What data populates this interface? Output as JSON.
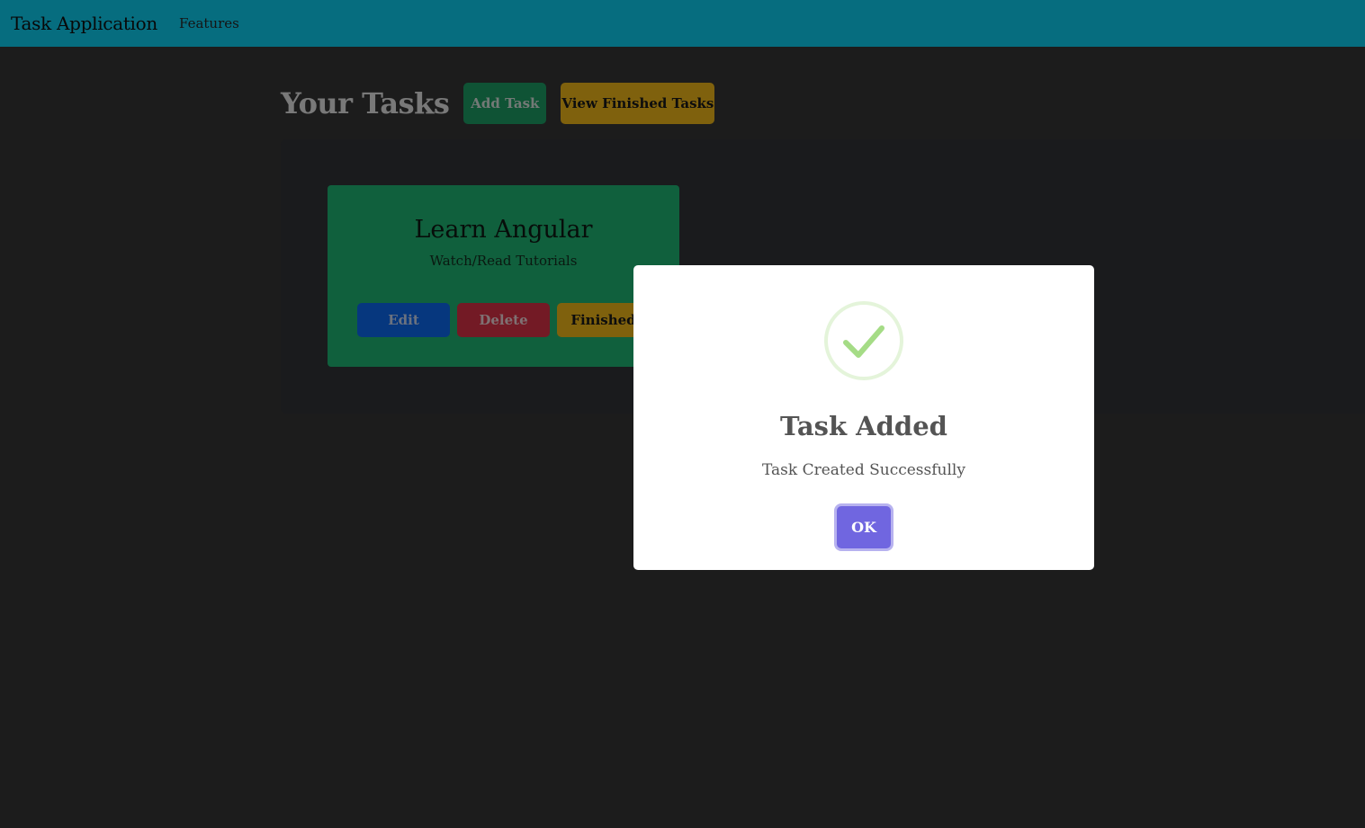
{
  "navbar": {
    "brand": "Task Application",
    "links": [
      "Features"
    ]
  },
  "main": {
    "title": "Your Tasks",
    "add_task_label": "Add Task",
    "view_finished_label": "View Finished Tasks"
  },
  "tasks": [
    {
      "title": "Learn Angular",
      "description": "Watch/Read Tutorials",
      "edit_label": "Edit",
      "delete_label": "Delete",
      "finished_label": "Finished"
    }
  ],
  "modal": {
    "icon": "check-icon",
    "title": "Task Added",
    "text": "Task Created Successfully",
    "ok_label": "OK"
  },
  "colors": {
    "navbar": "#0ddaff",
    "success_button": "#1ea76a",
    "warning_button": "#ffc21a",
    "primary_button": "#0d6efd",
    "danger_button": "#e6344a",
    "confirm_button": "#7066e0",
    "success_icon": "#a5dc86"
  }
}
